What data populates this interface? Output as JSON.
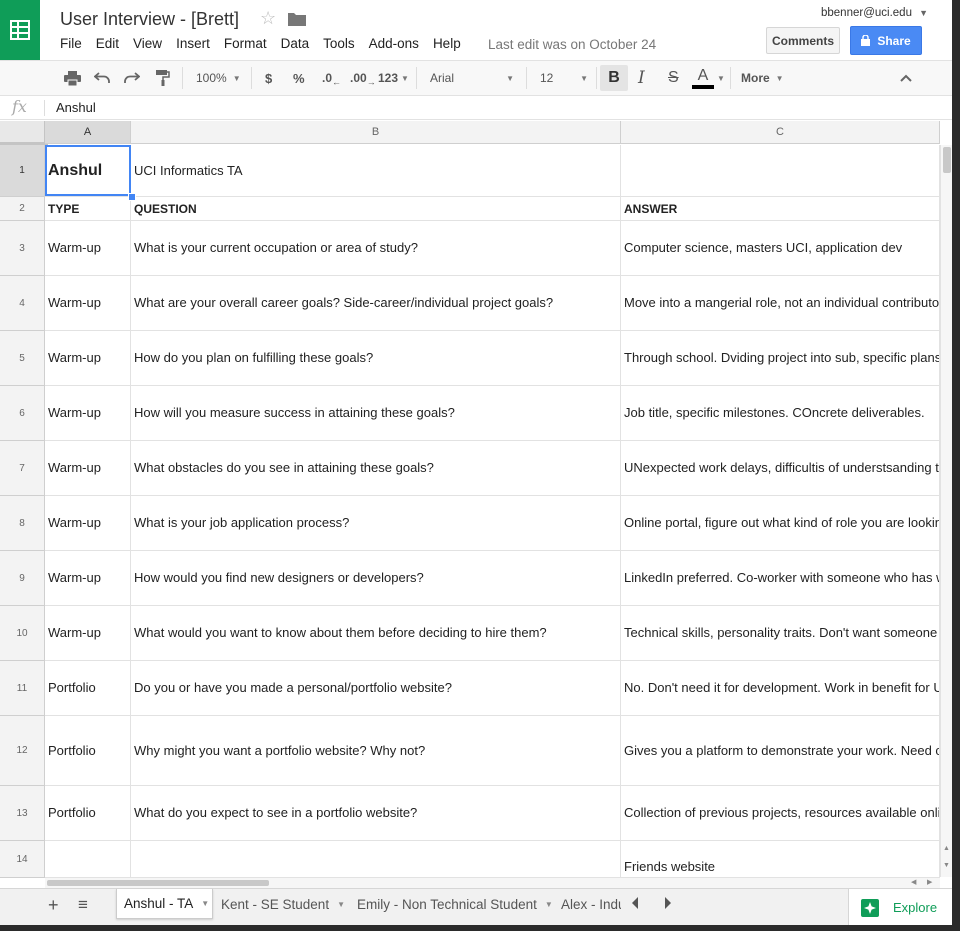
{
  "app": {
    "doc_title": "User Interview - [Brett]",
    "account": "bbenner@uci.edu",
    "last_edit": "Last edit was on October 24",
    "comments_label": "Comments",
    "share_label": "Share",
    "menu": [
      "File",
      "Edit",
      "View",
      "Insert",
      "Format",
      "Data",
      "Tools",
      "Add-ons",
      "Help"
    ]
  },
  "toolbar": {
    "zoom": "100%",
    "currency": "$",
    "percent": "%",
    "dec_decrease": ".0",
    "dec_increase": ".00",
    "more_formats": "123",
    "font": "Arial",
    "font_size": "12",
    "bold": "B",
    "italic": "I",
    "strike": "S",
    "text_color": "A",
    "more": "More",
    "text_color_value": "#000000"
  },
  "formula_bar": {
    "fx": "fx",
    "value": "Anshul"
  },
  "grid": {
    "columns": [
      "A",
      "B",
      "C"
    ],
    "rows": [
      {
        "num": "1",
        "a": "Anshul",
        "b": "UCI Informatics TA",
        "c": ""
      },
      {
        "num": "2",
        "a": "TYPE",
        "b": "QUESTION",
        "c": "ANSWER"
      },
      {
        "num": "3",
        "a": "Warm-up",
        "b": "What is your current occupation or area of study?",
        "c": "Computer science, masters UCI, application dev"
      },
      {
        "num": "4",
        "a": "Warm-up",
        "b": "What are your overall career goals? Side-career/individual project goals?",
        "c": "Move into a mangerial role, not an individual contributor\nof time. Not currently working on anything. Working related"
      },
      {
        "num": "5",
        "a": "Warm-up",
        "b": "How do you plan on fulfilling these goals?",
        "c": "Through school. Dviding project into sub, specific plans"
      },
      {
        "num": "6",
        "a": "Warm-up",
        "b": "How will you measure success in attaining these goals?",
        "c": "Job title, specific milestones. COncrete deliverables."
      },
      {
        "num": "7",
        "a": "Warm-up",
        "b": "What obstacles do you see in attaining these goals?",
        "c": "UNexpected work delays, difficultis of understsanding t\nBecause at times theyare times on info youre looking fo"
      },
      {
        "num": "8",
        "a": "Warm-up",
        "b": "What is your job application process?",
        "c": "Online portal, figure out what kind of role you are lookin\nrequirements. Find the role first. Github projects. Digita\nLinkedIn. Resumes of course. Provide GitHub and Link"
      },
      {
        "num": "9",
        "a": "Warm-up",
        "b": "How would you find new designers or developers?",
        "c": "LinkedIn preferred. Co-worker with someone who has w\nsource of information. Verified that person's credibility. C\nJobBoards."
      },
      {
        "num": "10",
        "a": "Warm-up",
        "b": "What would you want to know about them before deciding to hire them?",
        "c": "Technical skills, personality traits. Don't want someone\ntechnical roles you want womeone who is self reliant, le\ntraining."
      },
      {
        "num": "11",
        "a": "Portfolio",
        "b": "Do you or have you made a personal/portfolio website?",
        "c": "No. Don't need it for development. Work in benefit for U"
      },
      {
        "num": "12",
        "a": "Portfolio",
        "b": "Why might you want a portfolio website? Why not?",
        "c": "Gives you a platform to demonstrate your work. Need c\nTangible real evidence. Previous work experience, wha\nWhat have they been involved in education, profession\nthe UX UI domain. Short bio opens up the conversation"
      },
      {
        "num": "13",
        "a": "Portfolio",
        "b": "What do you expect to see in a portfolio website?",
        "c": "Collection of previous projects, resources available onli\nto their demos."
      },
      {
        "num": "14",
        "a": "",
        "b": "",
        "c": "Friends website"
      }
    ]
  },
  "sheets": {
    "add": "+",
    "list": "≡",
    "tabs": [
      {
        "label": "Anshul - TA"
      },
      {
        "label": "Kent - SE Student"
      },
      {
        "label": "Emily - Non Technical Student"
      },
      {
        "label": "Alex - Indu"
      }
    ],
    "explore_label": "Explore"
  },
  "colors": {
    "brand_green": "#0f9d58",
    "share_blue": "#4a8af4",
    "selection_blue": "#4285f4"
  }
}
